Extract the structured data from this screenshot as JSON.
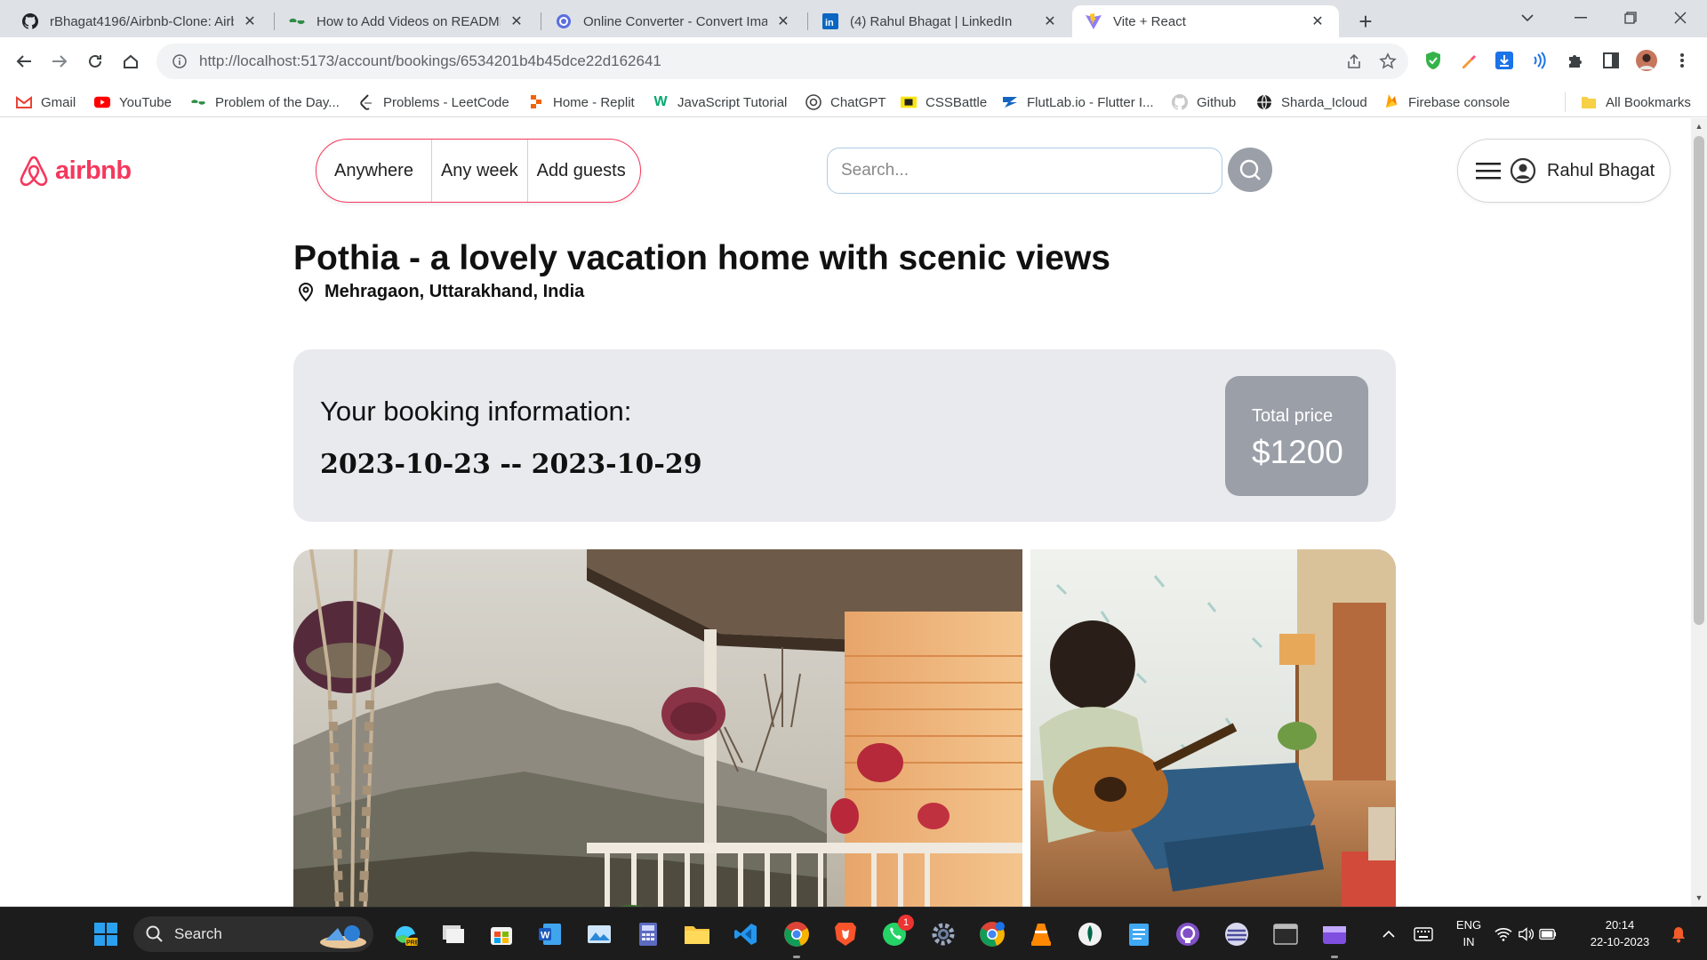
{
  "browser": {
    "tabs": [
      {
        "title": "rBhagat4196/Airbnb-Clone: Airbnb",
        "icon": "github-icon"
      },
      {
        "title": "How to Add Videos on README",
        "icon": "gfg-icon"
      },
      {
        "title": "Online Converter - Convert Images",
        "icon": "converter-icon"
      },
      {
        "title": "(4) Rahul Bhagat | LinkedIn",
        "icon": "linkedin-icon"
      },
      {
        "title": "Vite + React",
        "icon": "vite-icon",
        "active": true
      }
    ],
    "close_glyph": "✕",
    "new_tab_glyph": "+",
    "url": "http://localhost:5173/account/bookings/6534201b4b45dce22d162641",
    "bookmarks": [
      {
        "label": "Gmail",
        "icon": "gmail-icon"
      },
      {
        "label": "YouTube",
        "icon": "youtube-icon"
      },
      {
        "label": "Problem of the Day...",
        "icon": "gfg-icon"
      },
      {
        "label": "Problems - LeetCode",
        "icon": "leetcode-icon"
      },
      {
        "label": "Home - Replit",
        "icon": "replit-icon"
      },
      {
        "label": "JavaScript Tutorial",
        "icon": "w3schools-icon"
      },
      {
        "label": "ChatGPT",
        "icon": "chatgpt-icon"
      },
      {
        "label": "CSSBattle",
        "icon": "cssbattle-icon"
      },
      {
        "label": "FlutLab.io - Flutter I...",
        "icon": "flutlab-icon"
      },
      {
        "label": "Github",
        "icon": "github-icon"
      },
      {
        "label": "Sharda_Icloud",
        "icon": "globe-icon"
      },
      {
        "label": "Firebase console",
        "icon": "firebase-icon"
      }
    ],
    "all_bookmarks": "All Bookmarks"
  },
  "header": {
    "logo_text": "airbnb",
    "search_segments": [
      "Anywhere",
      "Any week",
      "Add guests"
    ],
    "search_placeholder": "Search...",
    "user_name": "Rahul Bhagat"
  },
  "place": {
    "title": "Pothia - a lovely vacation home with scenic views",
    "address": "Mehragaon, Uttarakhand, India"
  },
  "booking": {
    "label": "Your booking information:",
    "dates": "2023-10-23 -- 2023-10-29",
    "price_label": "Total price",
    "price_value": "$1200"
  },
  "colors": {
    "brand": "#f5385d",
    "card_bg": "#e9eaee",
    "price_bg": "#9a9fa8"
  },
  "taskbar": {
    "search_label": "Search",
    "lang_top": "ENG",
    "lang_bottom": "IN",
    "time": "20:14",
    "date": "22-10-2023",
    "whatsapp_badge": "1"
  }
}
